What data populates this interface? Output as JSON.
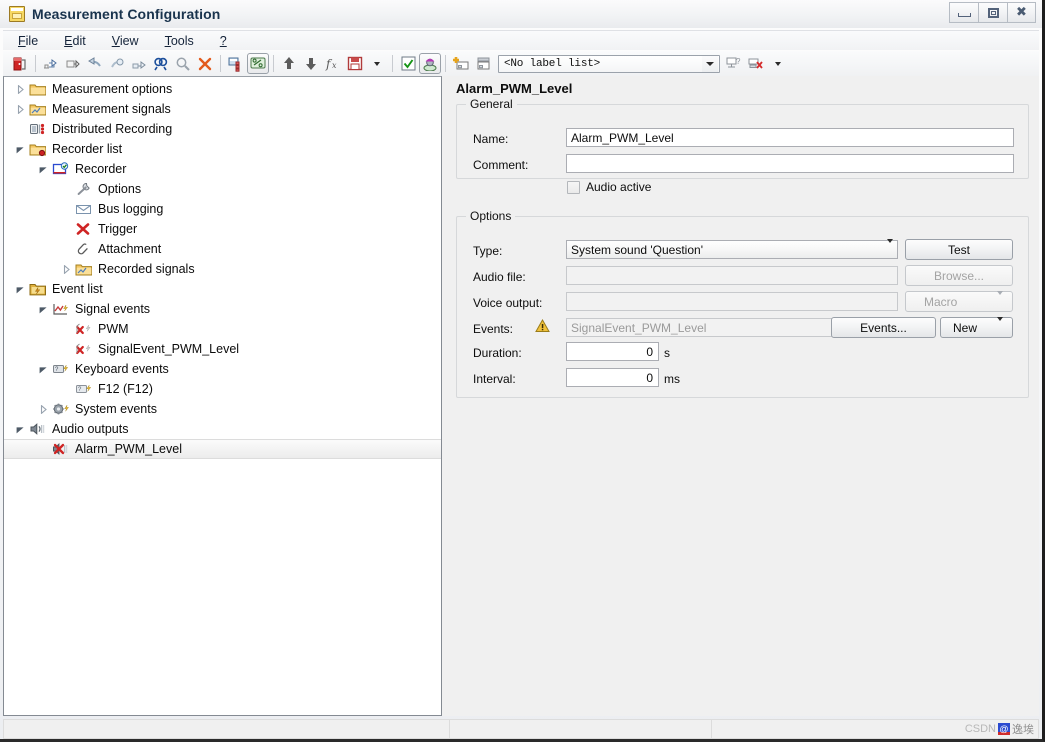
{
  "window": {
    "title": "Measurement Configuration",
    "icon": "app-window-icon",
    "buttons": {
      "minimize": "minimize",
      "restore": "restore",
      "close": "close"
    }
  },
  "menubar": {
    "items": [
      {
        "name": "file",
        "mnemonic": "F",
        "rest": "ile"
      },
      {
        "name": "edit",
        "mnemonic": "E",
        "rest": "dit"
      },
      {
        "name": "view",
        "mnemonic": "V",
        "rest": "iew"
      },
      {
        "name": "tools",
        "mnemonic": "T",
        "rest": "ools"
      },
      {
        "name": "help",
        "mnemonic": "?",
        "rest": ""
      }
    ]
  },
  "toolbar": {
    "buttons": [
      {
        "name": "exit-icon"
      },
      {
        "name": "import-measurement-setup-icon"
      },
      {
        "name": "export-measurement-setup-icon"
      },
      {
        "name": "undo-icon"
      },
      {
        "name": "redo-icon"
      },
      {
        "name": "link-icon"
      },
      {
        "name": "find-icon"
      },
      {
        "name": "zoom-icon"
      },
      {
        "name": "delete-icon"
      },
      {
        "name": "database-icon"
      },
      {
        "name": "symbol-mapping-icon"
      },
      {
        "name": "move-up-icon"
      },
      {
        "name": "move-down-icon"
      },
      {
        "name": "function-icon"
      },
      {
        "name": "save-icon"
      },
      {
        "name": "save-dropdown-icon"
      },
      {
        "name": "validate-icon"
      },
      {
        "name": "user-profile-icon"
      },
      {
        "name": "add-label-icon"
      },
      {
        "name": "edit-label-icon"
      }
    ],
    "label_list": {
      "value": "<No label list>",
      "placeholder": "<No label list>"
    },
    "right_buttons": [
      {
        "name": "assign-label-icon"
      },
      {
        "name": "remove-label-icon"
      },
      {
        "name": "label-options-dropdown-icon"
      }
    ]
  },
  "tree": {
    "items": [
      {
        "label": "Measurement options",
        "indent": 0,
        "twisty": "closed",
        "icon": "folder-icon",
        "selected": false
      },
      {
        "label": "Measurement signals",
        "indent": 0,
        "twisty": "closed",
        "icon": "folder-signals-icon",
        "selected": false
      },
      {
        "label": "Distributed Recording",
        "indent": 0,
        "twisty": "none",
        "icon": "distributed-recording-icon",
        "selected": false
      },
      {
        "label": "Recorder list",
        "indent": 0,
        "twisty": "open",
        "icon": "recorder-list-icon",
        "selected": false
      },
      {
        "label": "Recorder",
        "indent": 1,
        "twisty": "open",
        "icon": "recorder-icon",
        "selected": false
      },
      {
        "label": "Options",
        "indent": 2,
        "twisty": "none",
        "icon": "wrench-icon",
        "selected": false
      },
      {
        "label": "Bus logging",
        "indent": 2,
        "twisty": "none",
        "icon": "bus-logging-icon",
        "selected": false
      },
      {
        "label": "Trigger",
        "indent": 2,
        "twisty": "none",
        "icon": "trigger-icon",
        "selected": false
      },
      {
        "label": "Attachment",
        "indent": 2,
        "twisty": "none",
        "icon": "paperclip-icon",
        "selected": false
      },
      {
        "label": "Recorded signals",
        "indent": 2,
        "twisty": "closed",
        "icon": "folder-signals-icon",
        "selected": false
      },
      {
        "label": "Event list",
        "indent": 0,
        "twisty": "open",
        "icon": "event-list-icon",
        "selected": false
      },
      {
        "label": "Signal events",
        "indent": 1,
        "twisty": "open",
        "icon": "signal-events-icon",
        "selected": false
      },
      {
        "label": "PWM",
        "indent": 2,
        "twisty": "none",
        "icon": "signal-event-icon",
        "selected": false
      },
      {
        "label": "SignalEvent_PWM_Level",
        "indent": 2,
        "twisty": "none",
        "icon": "signal-event-icon",
        "selected": false
      },
      {
        "label": "Keyboard events",
        "indent": 1,
        "twisty": "open",
        "icon": "keyboard-events-icon",
        "selected": false
      },
      {
        "label": "F12 (F12)",
        "indent": 2,
        "twisty": "none",
        "icon": "keyboard-event-icon",
        "selected": false
      },
      {
        "label": "System events",
        "indent": 1,
        "twisty": "closed",
        "icon": "system-events-icon",
        "selected": false
      },
      {
        "label": "Audio outputs",
        "indent": 0,
        "twisty": "open",
        "icon": "audio-outputs-icon",
        "selected": false
      },
      {
        "label": "Alarm_PWM_Level",
        "indent": 1,
        "twisty": "none",
        "icon": "audio-output-alarm-icon",
        "selected": true
      }
    ]
  },
  "detail": {
    "title": "Alarm_PWM_Level",
    "general": {
      "legend": "General",
      "name_label": "Name:",
      "name_value": "Alarm_PWM_Level",
      "comment_label": "Comment:",
      "comment_value": "",
      "comment_placeholder": "",
      "audio_active_label": "Audio active",
      "audio_active_checked": false
    },
    "options": {
      "legend": "Options",
      "type_label": "Type:",
      "type_value": "System sound 'Question'",
      "test_button": "Test",
      "audio_file_label": "Audio file:",
      "audio_file_value": "",
      "browse_button": "Browse...",
      "voice_output_label": "Voice output:",
      "voice_output_value": "",
      "macro_button": "Macro",
      "events_label": "Events:",
      "events_value": "SignalEvent_PWM_Level",
      "events_warning_icon": "warning-icon",
      "events_button": "Events...",
      "new_button": "New",
      "duration_label": "Duration:",
      "duration_value": "0",
      "duration_unit": "s",
      "interval_label": "Interval:",
      "interval_value": "0",
      "interval_unit": "ms"
    }
  },
  "statusbar": {
    "cells": [
      "",
      "",
      ""
    ],
    "watermark_prefix": "CSDN",
    "watermark_badge": "@",
    "watermark_text": "逸埃"
  },
  "colors": {
    "accent": "#2b4ad0",
    "title_text": "#19334d",
    "selection": "#ececec",
    "panel_bg": "#f0f0f0",
    "warning": "#e8a317",
    "alert_red": "#cc2222"
  }
}
